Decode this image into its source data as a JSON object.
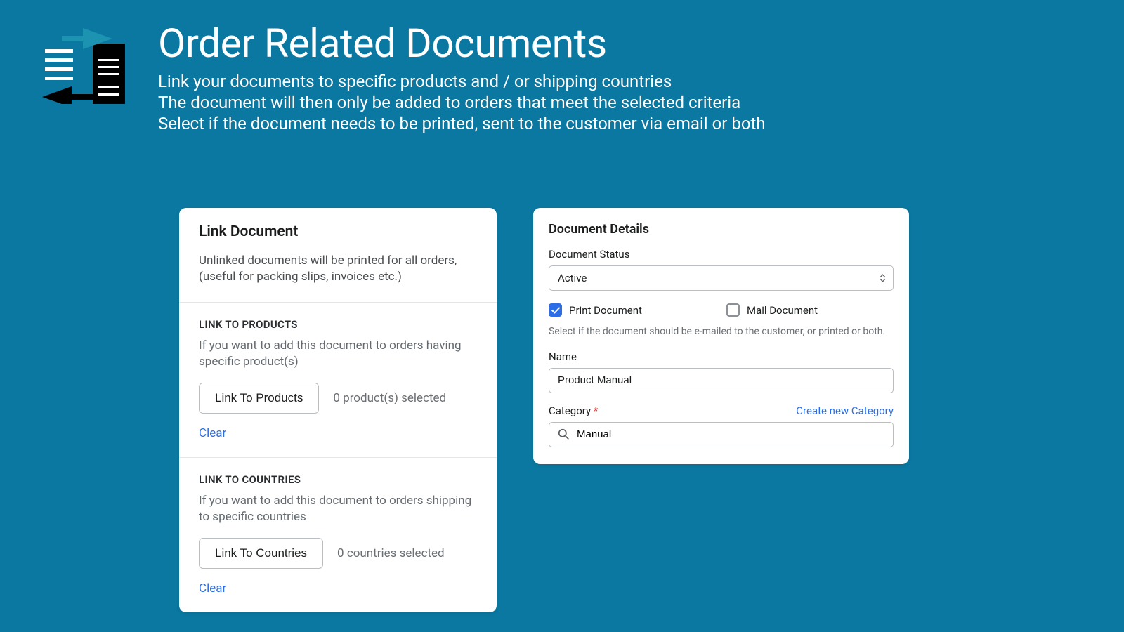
{
  "header": {
    "title": "Order Related Documents",
    "desc1": "Link your documents to specific products and / or shipping countries",
    "desc2": "The document will then only be added to orders that meet the selected criteria",
    "desc3": "Select if the document needs to be printed, sent to the customer via email or both"
  },
  "link_doc": {
    "title": "Link Document",
    "desc": "Unlinked documents will be printed for all orders, (useful for packing slips, invoices etc.)",
    "products": {
      "label": "LINK TO PRODUCTS",
      "desc": "If you want to add this document to orders having specific product(s)",
      "btn": "Link To Products",
      "count": "0 product(s) selected",
      "clear": "Clear"
    },
    "countries": {
      "label": "LINK TO COUNTRIES",
      "desc": "If you want to add this document to orders shipping to specific countries",
      "btn": "Link To Countries",
      "count": "0 countries selected",
      "clear": "Clear"
    }
  },
  "details": {
    "title": "Document Details",
    "status_label": "Document Status",
    "status_value": "Active",
    "print_label": "Print Document",
    "mail_label": "Mail Document",
    "help": "Select if the document should be e-mailed to the customer, or printed or both.",
    "name_label": "Name",
    "name_value": "Product Manual",
    "category_label": "Category",
    "category_create": "Create new Category",
    "category_value": "Manual"
  }
}
